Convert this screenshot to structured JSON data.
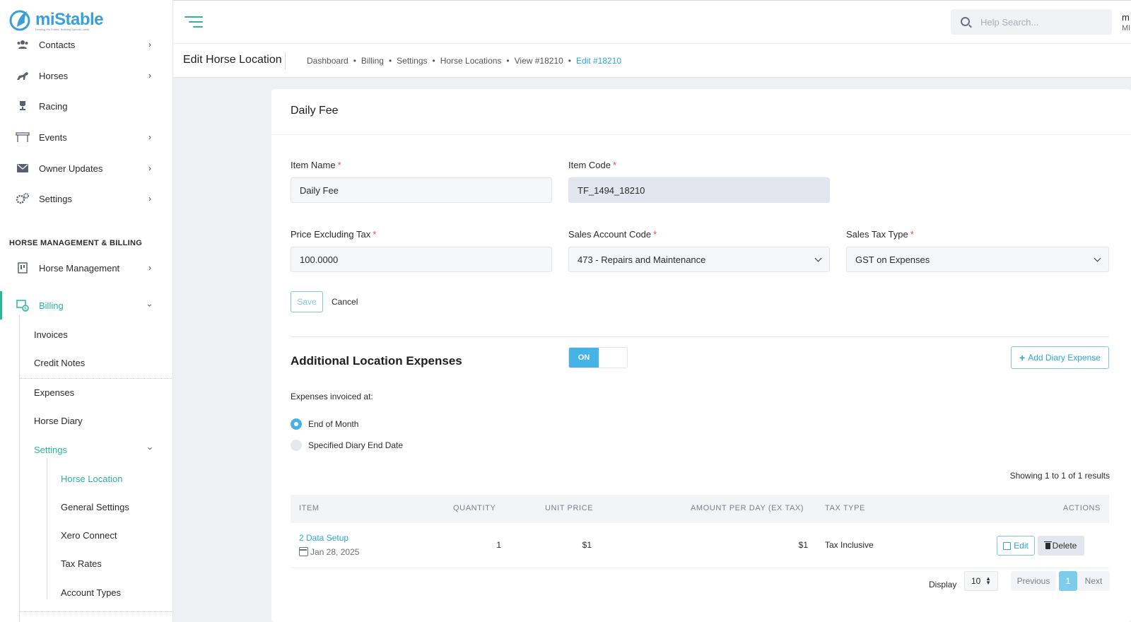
{
  "brand": {
    "name": "miStable",
    "tagline": "Leading the Future, Building Special Lands"
  },
  "sidebar": {
    "items": [
      {
        "label": "Contacts"
      },
      {
        "label": "Horses"
      },
      {
        "label": "Racing"
      },
      {
        "label": "Events"
      },
      {
        "label": "Owner Updates"
      },
      {
        "label": "Settings"
      }
    ],
    "section_title": "HORSE MANAGEMENT & BILLING",
    "hm": {
      "label": "Horse Management"
    },
    "billing": {
      "label": "Billing"
    },
    "billing_sub": [
      "Invoices",
      "Credit Notes",
      "Expenses",
      "Horse Diary"
    ],
    "settings_sub": {
      "label": "Settings"
    },
    "settings_items": [
      "Horse Location",
      "General Settings",
      "Xero Connect",
      "Tax Rates",
      "Account Types"
    ]
  },
  "topbar": {
    "search_placeholder": "Help Search...",
    "user_initial": "m",
    "user_sub": "MI"
  },
  "header": {
    "title": "Edit Horse Location",
    "breadcrumb": [
      "Dashboard",
      "Billing",
      "Settings",
      "Horse Locations",
      "View #18210",
      "Edit #18210"
    ]
  },
  "form": {
    "card_title": "Daily Fee",
    "item_name_label": "Item Name",
    "item_name_value": "Daily Fee",
    "item_code_label": "Item Code",
    "item_code_value": "TF_1494_18210",
    "price_label": "Price Excluding Tax",
    "price_value": "100.0000",
    "sales_account_label": "Sales Account Code",
    "sales_account_value": "473 - Repairs and Maintenance",
    "sales_tax_label": "Sales Tax Type",
    "sales_tax_value": "GST on Expenses",
    "required_mark": "*",
    "save_label": "Save",
    "cancel_label": "Cancel"
  },
  "expenses": {
    "title": "Additional Location Expenses",
    "toggle_label": "ON",
    "add_label": "Add Diary Expense",
    "invoiced_label": "Expenses invoiced at:",
    "radio_options": [
      "End of Month",
      "Specified Diary End Date"
    ],
    "selected_option": "End of Month",
    "showing": "Showing 1 to 1 of 1 results",
    "columns": [
      "ITEM",
      "QUANTITY",
      "UNIT PRICE",
      "AMOUNT PER DAY (EX TAX)",
      "TAX TYPE",
      "ACTIONS"
    ],
    "rows": [
      {
        "item": "2 Data Setup",
        "date": "Jan 28, 2025",
        "quantity": "1",
        "unit_price": "$1",
        "amount": "$1",
        "tax_type": "Tax Inclusive"
      }
    ],
    "edit_label": "Edit",
    "delete_label": "Delete"
  },
  "pager": {
    "display_label": "Display",
    "page_size": "10",
    "prev_label": "Previous",
    "current_page": "1",
    "next_label": "Next"
  },
  "colors": {
    "accent_green": "#2bb59a",
    "accent_blue": "#46b3e6",
    "link_blue": "#2aa8d6"
  }
}
